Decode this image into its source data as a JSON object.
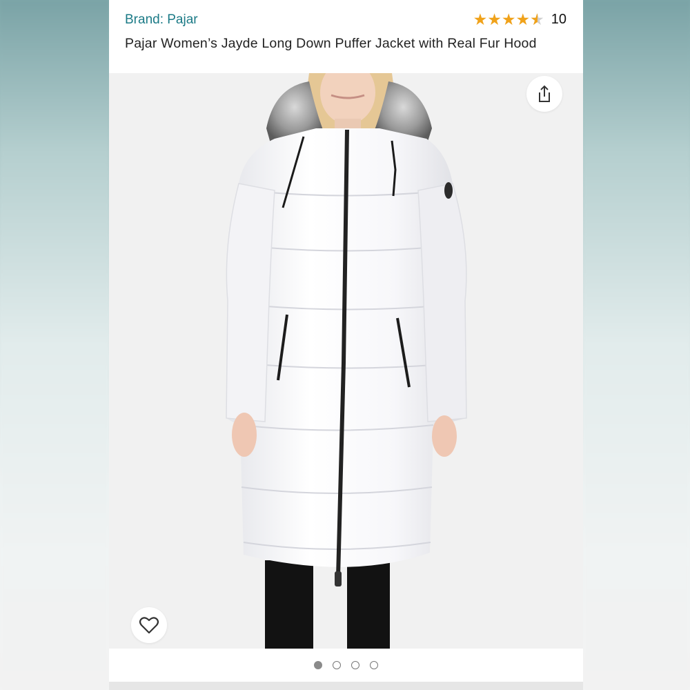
{
  "product": {
    "brand_label": "Brand: Pajar",
    "title": "Pajar Women’s Jayde Long Down Puffer Jacket with Real Fur Hood",
    "rating_value": 4.5,
    "rating_max": 5,
    "review_count": "10"
  },
  "gallery": {
    "image_count": 4,
    "active_index": 0
  },
  "colors": {
    "brand_link": "#1b7a86",
    "star_filled": "#f0a21a",
    "star_empty": "#cfcfcf"
  },
  "icons": {
    "share": "share-icon",
    "wishlist": "heart-outline-icon",
    "star": "star-icon"
  }
}
